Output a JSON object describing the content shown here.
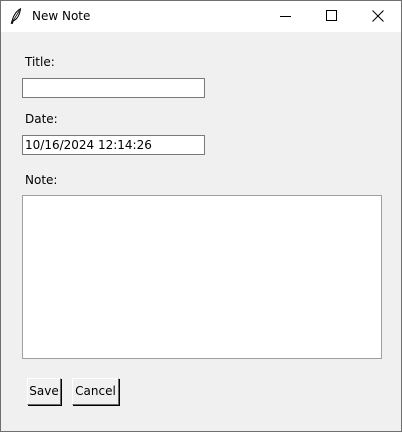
{
  "window": {
    "title": "New Note"
  },
  "form": {
    "title_label": "Title:",
    "title_value": "",
    "date_label": "Date:",
    "date_value": "10/16/2024 12:14:26",
    "note_label": "Note:",
    "note_value": ""
  },
  "buttons": {
    "save": "Save",
    "cancel": "Cancel"
  },
  "icons": {
    "app": "feather-icon",
    "minimize": "minimize-icon",
    "maximize": "maximize-icon",
    "close": "close-icon"
  }
}
